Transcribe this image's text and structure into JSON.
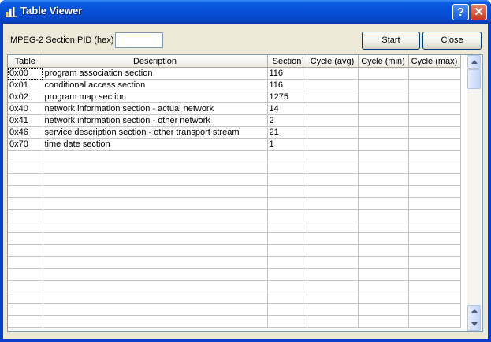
{
  "window": {
    "title": "Table Viewer",
    "help_label": "?",
    "close_label": "✕",
    "icon": "bar-chart-icon"
  },
  "toolbar": {
    "pid_label": "MPEG-2 Section PID (hex)",
    "pid_value": "",
    "start_label": "Start",
    "close_label": "Close"
  },
  "table": {
    "columns": [
      "Table",
      "Description",
      "Section",
      "Cycle (avg)",
      "Cycle (min)",
      "Cycle (max)"
    ],
    "rows": [
      [
        "0x00",
        "program association section",
        "116",
        "",
        "",
        ""
      ],
      [
        "0x01",
        "conditional access section",
        "116",
        "",
        "",
        ""
      ],
      [
        "0x02",
        "program map section",
        "1275",
        "",
        "",
        ""
      ],
      [
        "0x40",
        "network information section - actual network",
        "14",
        "",
        "",
        ""
      ],
      [
        "0x41",
        "network information section - other network",
        "2",
        "",
        "",
        ""
      ],
      [
        "0x46",
        "service description section - other transport stream",
        "21",
        "",
        "",
        ""
      ],
      [
        "0x70",
        "time date section",
        "1",
        "",
        "",
        ""
      ]
    ]
  },
  "colors": {
    "titlebar": "#0a5be0",
    "client_bg": "#ece9d8",
    "grid_line": "#c5c5c5"
  }
}
